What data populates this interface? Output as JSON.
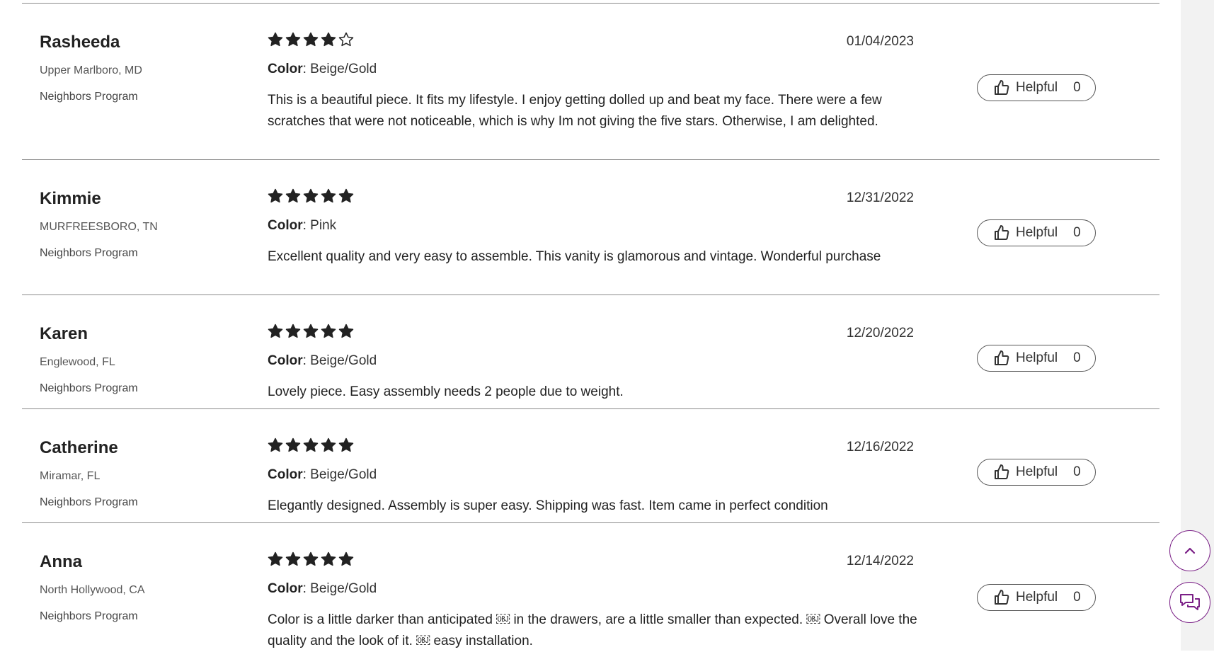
{
  "colors": {
    "accent": "#7a1f86",
    "star": "#222222",
    "divider": "#8c8c8c"
  },
  "labels": {
    "color_key": "Color",
    "helpful": "Helpful"
  },
  "floating": {
    "scroll_top_icon": "chevron-up-icon",
    "chat_icon": "chat-icon"
  },
  "reviews": [
    {
      "name": "Rasheeda",
      "location": "Upper Marlboro, MD",
      "program": "Neighbors Program",
      "rating": 4,
      "date": "01/04/2023",
      "color": "Beige/Gold",
      "text": "This is a beautiful piece. It fits my lifestyle. I enjoy getting dolled up and beat my face. There were a few scratches that were not noticeable, which is why Im not giving the five stars. Otherwise, I am delighted.",
      "helpful_count": "0"
    },
    {
      "name": "Kimmie",
      "location": "MURFREESBORO, TN",
      "program": "Neighbors Program",
      "rating": 5,
      "date": "12/31/2022",
      "color": "Pink",
      "text": "Excellent quality and very easy to assemble. This vanity is glamorous and vintage. Wonderful purchase",
      "helpful_count": "0"
    },
    {
      "name": "Karen",
      "location": "Englewood, FL",
      "program": "Neighbors Program",
      "rating": 5,
      "date": "12/20/2022",
      "color": "Beige/Gold",
      "text": "Lovely piece. Easy assembly needs 2 people due to weight.",
      "helpful_count": "0"
    },
    {
      "name": "Catherine",
      "location": "Miramar, FL",
      "program": "Neighbors Program",
      "rating": 5,
      "date": "12/16/2022",
      "color": "Beige/Gold",
      "text": "Elegantly designed. Assembly is super easy. Shipping was fast. Item came in perfect condition",
      "helpful_count": "0"
    },
    {
      "name": "Anna",
      "location": "North Hollywood, CA",
      "program": "Neighbors Program",
      "rating": 5,
      "date": "12/14/2022",
      "color": "Beige/Gold",
      "text": "Color is a little darker than anticipated ￼ in the drawers, are a little smaller than expected. ￼ Overall love the quality and the look of it. ￼ easy installation.",
      "helpful_count": "0"
    }
  ]
}
